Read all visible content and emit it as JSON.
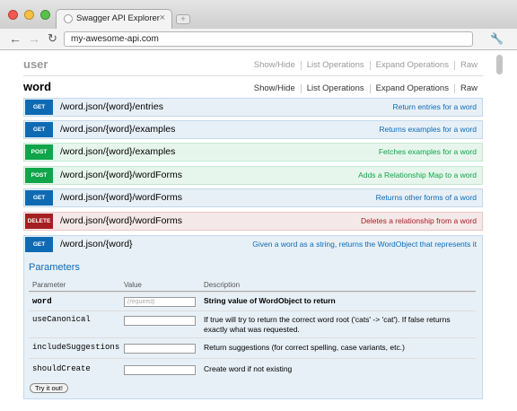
{
  "browser": {
    "tab_title": "Swagger API Explorer",
    "tab_close": "×",
    "url": "my-awesome-api.com",
    "back_glyph": "←",
    "forward_glyph": "→",
    "reload_glyph": "↻",
    "menu_glyph": "🔧",
    "newtab_glyph": "+"
  },
  "resources": {
    "user": {
      "name": "user",
      "links": [
        "Show/Hide",
        "List Operations",
        "Expand Operations",
        "Raw"
      ]
    },
    "word": {
      "name": "word",
      "links": [
        "Show/Hide",
        "List Operations",
        "Expand Operations",
        "Raw"
      ]
    }
  },
  "operations": [
    {
      "method": "GET",
      "path": "/word.json/{word}/entries",
      "summary": "Return entries for a word"
    },
    {
      "method": "GET",
      "path": "/word.json/{word}/examples",
      "summary": "Returns examples for a word"
    },
    {
      "method": "POST",
      "path": "/word.json/{word}/examples",
      "summary": "Fetches examples for a word"
    },
    {
      "method": "POST",
      "path": "/word.json/{word}/wordForms",
      "summary": "Adds a Relationship Map to a word"
    },
    {
      "method": "GET",
      "path": "/word.json/{word}/wordForms",
      "summary": "Returns other forms of a word"
    },
    {
      "method": "DELETE",
      "path": "/word.json/{word}/wordForms",
      "summary": "Deletes a relationship from a word"
    },
    {
      "method": "GET",
      "path": "/word.json/{word}",
      "summary": "Given a word as a string, returns the WordObject that represents it"
    }
  ],
  "parameters": {
    "title": "Parameters",
    "headers": [
      "Parameter",
      "Value",
      "Description"
    ],
    "rows": [
      {
        "name": "word",
        "placeholder": "(required)",
        "value": "",
        "description": "String value of WordObject to return"
      },
      {
        "name": "useCanonical",
        "placeholder": "",
        "value": "",
        "description": "If true will try to return the correct word root ('cats' -> 'cat'). If false returns exactly what was requested."
      },
      {
        "name": "includeSuggestions",
        "placeholder": "",
        "value": "",
        "description": "Return suggestions (for correct spelling, case variants, etc.)"
      },
      {
        "name": "shouldCreate",
        "placeholder": "",
        "value": "",
        "description": "Create word if not existing"
      }
    ],
    "try_button": "Try it out!"
  },
  "colors": {
    "get": "#0f6ab4",
    "post": "#10a54a",
    "delete": "#a41e22"
  }
}
